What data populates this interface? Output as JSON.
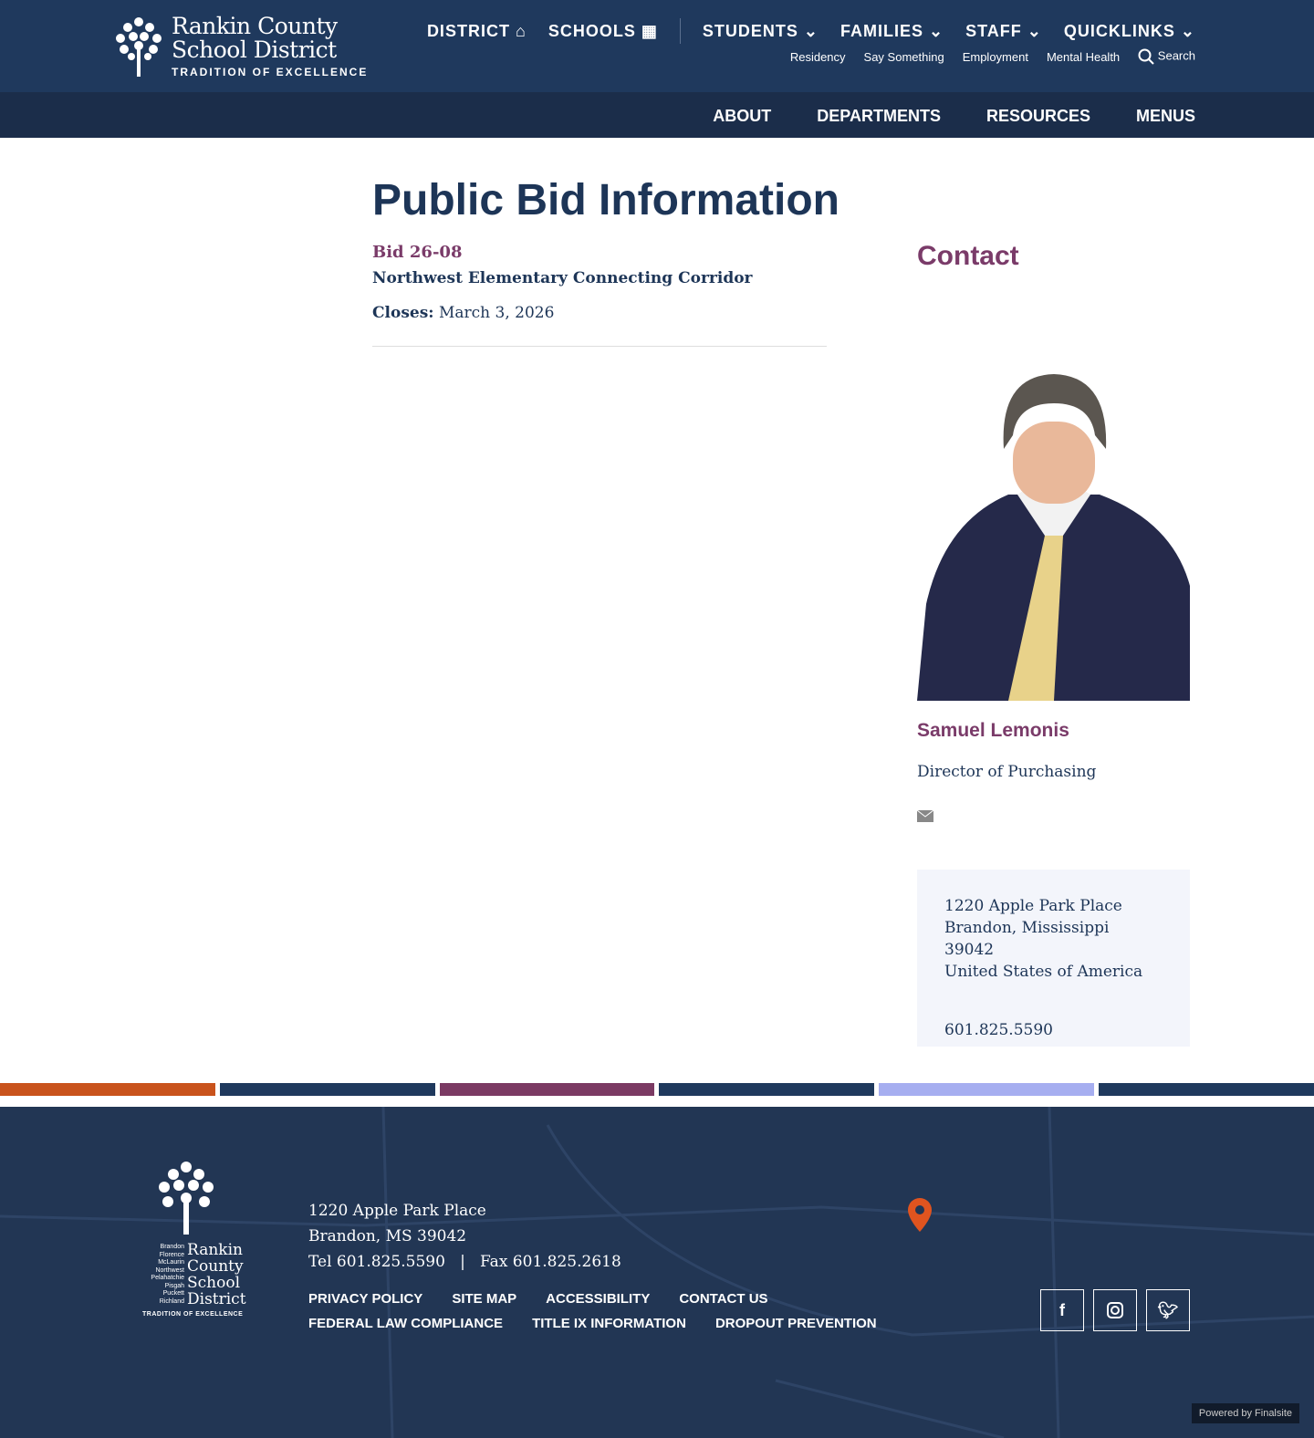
{
  "header": {
    "logo": {
      "name": "Rankin County School District",
      "line1": "Rankin County",
      "line2": "School District",
      "tagline": "TRADITION OF EXCELLENCE"
    },
    "main_nav": [
      "DISTRICT",
      "SCHOOLS",
      "STUDENTS",
      "FAMILIES",
      "STAFF",
      "QUICKLINKS"
    ],
    "sub_nav": [
      "Residency",
      "Say Something",
      "Employment",
      "Mental Health"
    ],
    "search_label": "Search",
    "secondary_nav": [
      "ABOUT",
      "DEPARTMENTS",
      "RESOURCES",
      "MENUS"
    ]
  },
  "page": {
    "title": "Public Bid Information",
    "bid_number": "Bid 26-08",
    "bid_name": "Northwest Elementary Connecting Corridor",
    "closes_label": "Closes:",
    "closes_date": "March 3, 2026"
  },
  "contact": {
    "heading": "Contact",
    "name": "Samuel Lemonis",
    "title": "Director of Purchasing",
    "address": [
      "1220 Apple Park Place",
      "Brandon, Mississippi  39042",
      "United States of America"
    ],
    "phone": "601.825.5590"
  },
  "stripe_colors": [
    "#c9531c",
    "#1f395d",
    "#7b3a63",
    "#1f395d",
    "#a6aef0",
    "#1f395d"
  ],
  "footer": {
    "logo_schools": [
      "Brandon",
      "Florence",
      "McLaurin",
      "Northwest",
      "Pelahatchie",
      "Pisgah",
      "Puckett",
      "Richland"
    ],
    "logo_text": "Rankin County School District",
    "logo_tagline": "TRADITION OF EXCELLENCE",
    "address1": "1220 Apple Park Place",
    "address2": "Brandon, MS 39042",
    "phone": "Tel 601.825.5590   |   Fax 601.825.2618",
    "links": [
      "PRIVACY POLICY",
      "SITE MAP",
      "ACCESSIBILITY",
      "CONTACT US",
      "FEDERAL LAW COMPLIANCE",
      "TITLE IX INFORMATION",
      "DROPOUT PREVENTION"
    ],
    "social": [
      "facebook-icon",
      "instagram-icon",
      "twitter-icon"
    ],
    "powered": "Powered by Finalsite"
  }
}
